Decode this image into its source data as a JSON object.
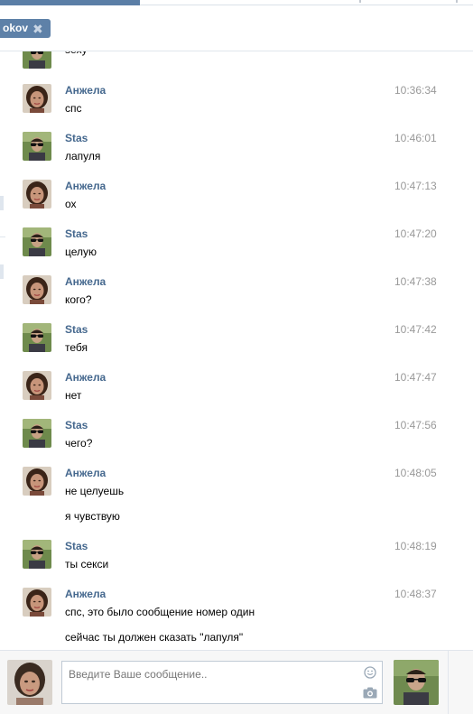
{
  "tab": {
    "name": "okov",
    "close": "✖"
  },
  "messages": [
    {
      "author": "",
      "time": "",
      "ava": "stas",
      "lines": [
        "sexy"
      ]
    },
    {
      "author": "Анжела",
      "time": "10:36:34",
      "ava": "angela",
      "lines": [
        "спс"
      ]
    },
    {
      "author": "Stas",
      "time": "10:46:01",
      "ava": "stas",
      "lines": [
        "лапуля"
      ]
    },
    {
      "author": "Анжела",
      "time": "10:47:13",
      "ava": "angela",
      "lines": [
        "ох"
      ]
    },
    {
      "author": "Stas",
      "time": "10:47:20",
      "ava": "stas",
      "lines": [
        "целую"
      ]
    },
    {
      "author": "Анжела",
      "time": "10:47:38",
      "ava": "angela",
      "lines": [
        "кого?"
      ]
    },
    {
      "author": "Stas",
      "time": "10:47:42",
      "ava": "stas",
      "lines": [
        "тебя"
      ]
    },
    {
      "author": "Анжела",
      "time": "10:47:47",
      "ava": "angela",
      "lines": [
        "нет"
      ]
    },
    {
      "author": "Stas",
      "time": "10:47:56",
      "ava": "stas",
      "lines": [
        "чего?"
      ]
    },
    {
      "author": "Анжела",
      "time": "10:48:05",
      "ava": "angela",
      "lines": [
        "не целуешь",
        "я чувствую"
      ]
    },
    {
      "author": "Stas",
      "time": "10:48:19",
      "ava": "stas",
      "lines": [
        "ты секси"
      ]
    },
    {
      "author": "Анжела",
      "time": "10:48:37",
      "ava": "angela",
      "lines": [
        "спс, это было сообщение номер один",
        "сейчас ты должен сказать \"лапуля\""
      ]
    }
  ],
  "composer": {
    "placeholder": "Введите Ваше сообщение.."
  },
  "colors": {
    "link": "#45688e",
    "accent": "#5e81a8",
    "time": "#999999"
  }
}
